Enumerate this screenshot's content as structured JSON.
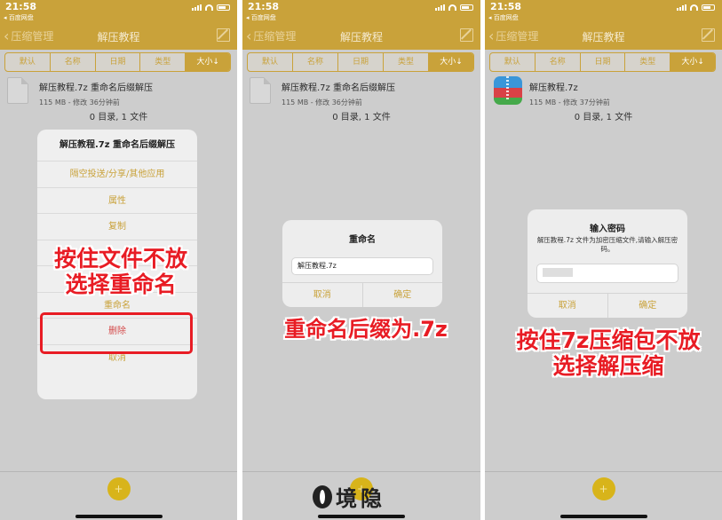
{
  "status_bar": {
    "time": "21:58",
    "back_app": "◂ 百度网盘"
  },
  "nav": {
    "back_label": "压缩管理",
    "title": "解压教程"
  },
  "sort_tabs": [
    "默认",
    "名称",
    "日期",
    "类型",
    "大小↓"
  ],
  "panels": [
    {
      "file_name": "解压教程.7z 重命名后缀解压",
      "file_meta": "115 MB - 修改 36分钟前",
      "summary": "0 目录, 1 文件",
      "action_sheet": {
        "title": "解压教程.7z 重命名后缀解压",
        "items": [
          {
            "label": "隔空投送/分享/其他应用"
          },
          {
            "label": "属性"
          },
          {
            "label": "复制"
          },
          {
            "label": ""
          },
          {
            "label": ""
          },
          {
            "label": "重命名"
          },
          {
            "label": "删除"
          },
          {
            "label": "取消"
          }
        ]
      },
      "annotation": [
        "按住文件不放",
        "选择重命名"
      ]
    },
    {
      "file_name": "解压教程.7z 重命名后缀解压",
      "file_meta": "115 MB - 修改 36分钟前",
      "summary": "0 目录, 1 文件",
      "dialog": {
        "title": "重命名",
        "input_value": "解压教程.7z",
        "cancel": "取消",
        "confirm": "确定"
      },
      "annotation": [
        "重命名后缀为.7z"
      ]
    },
    {
      "file_name": "解压教程.7z",
      "file_meta": "115 MB - 修改 37分钟前",
      "summary": "0 目录, 1 文件",
      "dialog": {
        "title": "输入密码",
        "message": "解压教程.7z 文件为加密压缩文件,请输入解压密码。",
        "input_value": "",
        "cancel": "取消",
        "confirm": "确定"
      },
      "annotation": [
        "按住7z压缩包不放",
        "选择解压缩"
      ]
    }
  ],
  "add_button": "+",
  "watermark": "境隐",
  "colors": {
    "accent": "#c9a23a",
    "annotation_red": "#e81c24",
    "add_button": "#d8b41a"
  }
}
